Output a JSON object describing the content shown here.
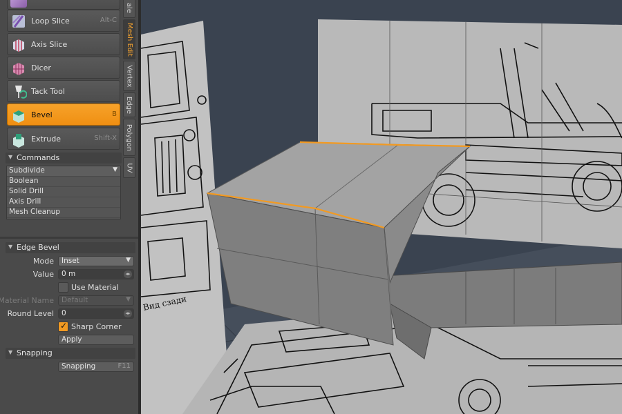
{
  "tools": [
    {
      "label": "Loop Slice",
      "shortcut": "Alt-C",
      "icon": "loop-slice-icon"
    },
    {
      "label": "Axis Slice",
      "shortcut": "",
      "icon": "axis-slice-icon"
    },
    {
      "label": "Dicer",
      "shortcut": "",
      "icon": "dicer-icon"
    },
    {
      "label": "Tack Tool",
      "shortcut": "",
      "icon": "tack-tool-icon"
    },
    {
      "label": "Bevel",
      "shortcut": "B",
      "icon": "bevel-icon",
      "active": true
    },
    {
      "label": "Extrude",
      "shortcut": "Shift-X",
      "icon": "extrude-icon"
    }
  ],
  "vertical_tabs": [
    "ale",
    "Mesh Edit",
    "Vertex",
    "Edge",
    "Polygon",
    "UV"
  ],
  "active_tab": "Mesh Edit",
  "commands": {
    "title": "Commands",
    "items": [
      "Subdivide",
      "Boolean",
      "Solid Drill",
      "Axis Drill",
      "Mesh Cleanup"
    ]
  },
  "edge_bevel": {
    "title": "Edge Bevel",
    "mode_label": "Mode",
    "mode_value": "Inset",
    "value_label": "Value",
    "value_value": "0 m",
    "use_material_label": "Use Material",
    "use_material": false,
    "material_name_label": "Material Name",
    "material_name_value": "Default",
    "round_level_label": "Round Level",
    "round_level_value": "0",
    "sharp_corner_label": "Sharp Corner",
    "sharp_corner": true,
    "apply_label": "Apply"
  },
  "snapping": {
    "title": "Snapping",
    "button_label": "Snapping",
    "shortcut": "F11"
  },
  "colors": {
    "accent": "#f29a22",
    "panel": "#4a4a4a",
    "viewport_bg": "#3a4350",
    "mesh": "#7a7a7a"
  }
}
